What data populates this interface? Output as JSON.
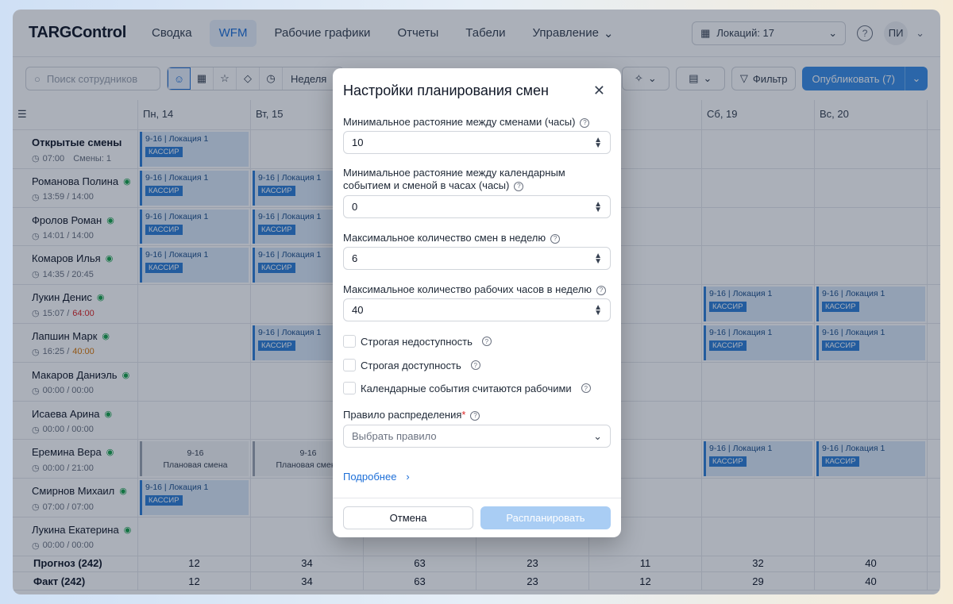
{
  "header": {
    "logo": "TARGControl",
    "nav": [
      "Сводка",
      "WFM",
      "Рабочие графики",
      "Отчеты",
      "Табели",
      "Управление"
    ],
    "location": "Локаций: 17",
    "avatar": "ПИ"
  },
  "toolbar": {
    "search_placeholder": "Поиск сотрудников",
    "period": "Неделя",
    "filter": "Фильтр",
    "publish": "Опубликовать (7)"
  },
  "days": [
    "Пн, 14",
    "Вт, 15",
    "",
    "",
    "",
    "Сб, 19",
    "Вс, 20"
  ],
  "open_shifts": {
    "title": "Открытые смены",
    "time": "07:00",
    "count": "Смены: 1"
  },
  "employees": [
    {
      "name": "Романова Полина",
      "meta": "13:59 / 14:00"
    },
    {
      "name": "Фролов Роман",
      "meta": "14:01 / 14:00"
    },
    {
      "name": "Комаров Илья",
      "meta": "14:35 / 20:45"
    },
    {
      "name": "Лукин Денис",
      "meta": "15:07 / ",
      "extra": "64:00"
    },
    {
      "name": "Лапшин Марк",
      "meta": "16:25 / ",
      "extra": "40:00"
    },
    {
      "name": "Макаров Даниэль",
      "meta": "00:00 / 00:00"
    },
    {
      "name": "Исаева Арина",
      "meta": "00:00 / 00:00"
    },
    {
      "name": "Еремина Вера",
      "meta": "00:00 / 21:00"
    },
    {
      "name": "Смирнов Михаил",
      "meta": "07:00 / 07:00"
    },
    {
      "name": "Лукина Екатерина",
      "meta": "00:00 / 00:00"
    }
  ],
  "shift": {
    "time_loc": "9-16 | Локация 1",
    "role": "КАССИР",
    "plan_time": "9-16",
    "plan_label": "Плановая смена"
  },
  "summary": {
    "forecast_label": "Прогноз (242)",
    "fact_label": "Факт (242)",
    "forecast": [
      "12",
      "34",
      "63",
      "23",
      "11",
      "32",
      "40"
    ],
    "fact": [
      "12",
      "34",
      "63",
      "23",
      "12",
      "29",
      "40"
    ]
  },
  "modal": {
    "title": "Настройки планирования смен",
    "min_gap_label": "Минимальное растояние между сменами (часы)",
    "min_gap_value": "10",
    "min_event_gap_label": "Минимальное растояние между календарным событием и сменой в часах (часы)",
    "min_event_gap_value": "0",
    "max_shifts_label": "Максимальное количество смен в неделю",
    "max_shifts_value": "6",
    "max_hours_label": "Максимальное количество рабочих часов в неделю",
    "max_hours_value": "40",
    "check_unavailability": "Строгая недоступность",
    "check_availability": "Строгая доступность",
    "check_events_working": "Календарные события считаются рабочими",
    "rule_label": "Правило распределения",
    "rule_placeholder": "Выбрать правило",
    "more": "Подробнее",
    "cancel": "Отмена",
    "submit": "Распланировать"
  }
}
